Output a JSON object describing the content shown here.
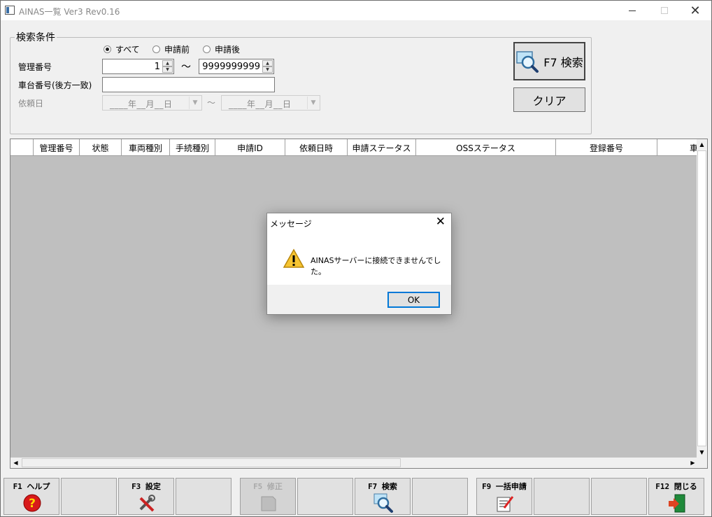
{
  "window": {
    "title": "AINAS一覧 Ver3 Rev0.16"
  },
  "search": {
    "legend": "検索条件",
    "radios": [
      {
        "label": "すべて",
        "selected": true
      },
      {
        "label": "申請前",
        "selected": false
      },
      {
        "label": "申請後",
        "selected": false
      }
    ],
    "kanri_label": "管理番号",
    "kanri_from": "1",
    "kanri_to": "9999999999",
    "range_sep": "～",
    "chassis_label": "車台番号(後方一致)",
    "chassis_value": "",
    "date_label": "依頼日",
    "date_placeholder": "____年__月__日",
    "date_sep": "～",
    "search_button": "F7 検索",
    "clear_button": "クリア"
  },
  "grid": {
    "columns": [
      "",
      "管理番号",
      "状態",
      "車両種別",
      "手続種別",
      "申請ID",
      "依頼日時",
      "申請ステータス",
      "OSSステータス",
      "登録番号",
      "車"
    ]
  },
  "fkeys": [
    {
      "label": "F1 ヘルプ",
      "icon": "help-icon",
      "enabled": true
    },
    {
      "label": "",
      "icon": "",
      "enabled": true
    },
    {
      "label": "F3 設定",
      "icon": "settings-tools-icon",
      "enabled": true
    },
    {
      "label": "",
      "icon": "",
      "enabled": true
    },
    {
      "label": "F5 修正",
      "icon": "edit-icon",
      "enabled": false
    },
    {
      "label": "",
      "icon": "",
      "enabled": true
    },
    {
      "label": "F7 検索",
      "icon": "search-icon",
      "enabled": true
    },
    {
      "label": "",
      "icon": "",
      "enabled": true
    },
    {
      "label": "F9 一括申請",
      "icon": "batch-apply-icon",
      "enabled": true
    },
    {
      "label": "",
      "icon": "",
      "enabled": true
    },
    {
      "label": "",
      "icon": "",
      "enabled": true
    },
    {
      "label": "F12 閉じる",
      "icon": "exit-door-icon",
      "enabled": true
    }
  ],
  "dialog": {
    "title": "メッセージ",
    "message": "AINASサーバーに接続できませんでした。",
    "ok_button": "OK",
    "icon": "warning-icon"
  }
}
